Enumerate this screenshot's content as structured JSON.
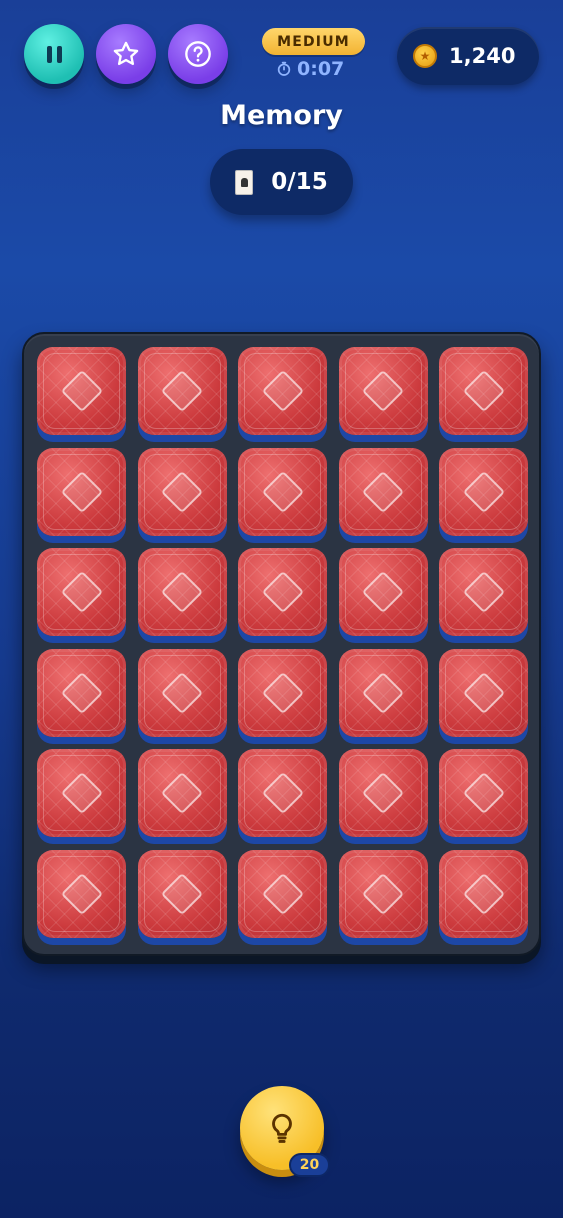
{
  "header": {
    "difficulty": "MEDIUM",
    "timer": "0:07",
    "coins": "1,240"
  },
  "title": "Memory",
  "progress": {
    "matched": "0/15"
  },
  "board": {
    "rows": 6,
    "cols": 5,
    "cards_face_down": 30
  },
  "hint": {
    "count": "20"
  },
  "icons": {
    "pause": "pause-icon",
    "star": "star-icon",
    "help": "help-icon",
    "timer": "stopwatch-icon",
    "coin": "coin-icon",
    "cards": "card-icon",
    "hint": "lightbulb-icon"
  },
  "colors": {
    "pause_button": "#2fd3c6",
    "star_button": "#8c55f2",
    "help_button": "#8c55f2",
    "difficulty_badge": "#f5c042",
    "card_back": "#d2444a",
    "hint_button": "#f8c530"
  }
}
